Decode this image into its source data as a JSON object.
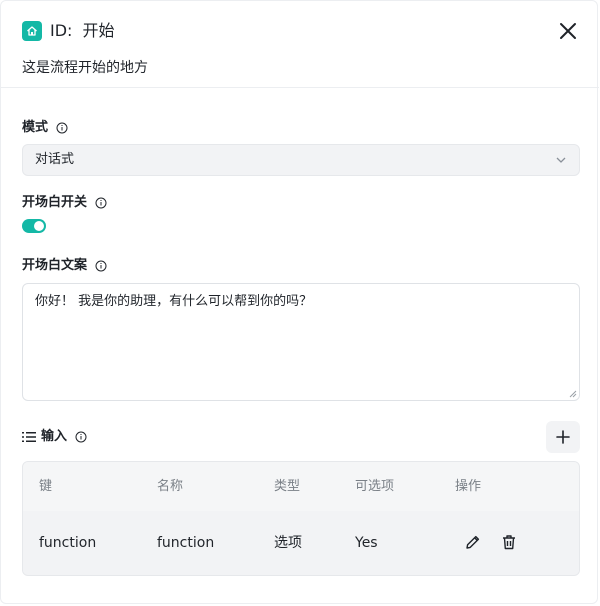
{
  "header": {
    "id_label": "ID:",
    "node_name": "开始",
    "description": "这是流程开始的地方"
  },
  "mode": {
    "label": "模式",
    "value": "对话式"
  },
  "opening_switch": {
    "label": "开场白开关",
    "enabled": true
  },
  "opening_text": {
    "label": "开场白文案",
    "value": "你好！ 我是你的助理，有什么可以帮到你的吗？"
  },
  "inputs": {
    "label": "输入",
    "columns": [
      "键",
      "名称",
      "类型",
      "可选项",
      "操作"
    ],
    "rows": [
      {
        "key": "function",
        "name": "function",
        "type": "选项",
        "optional": "Yes"
      }
    ]
  },
  "colors": {
    "accent": "#14b8a6"
  }
}
